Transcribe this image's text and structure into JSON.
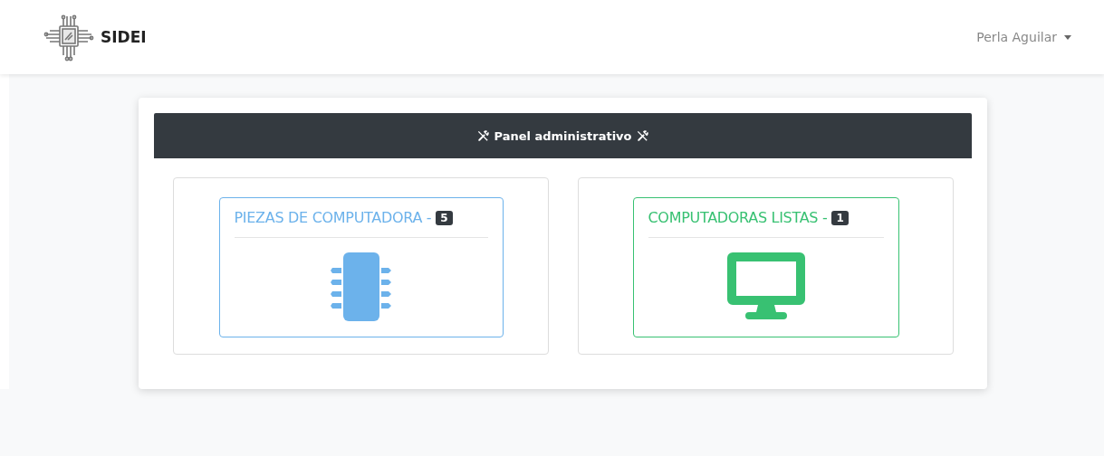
{
  "navbar": {
    "brand": "SIDEI",
    "user_menu": "Perla Aguilar"
  },
  "panel": {
    "title": "Panel administrativo"
  },
  "cards": [
    {
      "title": "PIEZAS DE COMPUTADORA -",
      "count": "5",
      "color": "#6cb2eb",
      "kind": "chip"
    },
    {
      "title": "COMPUTADORAS LISTAS -",
      "count": "1",
      "color": "#38c172",
      "kind": "monitor"
    }
  ]
}
